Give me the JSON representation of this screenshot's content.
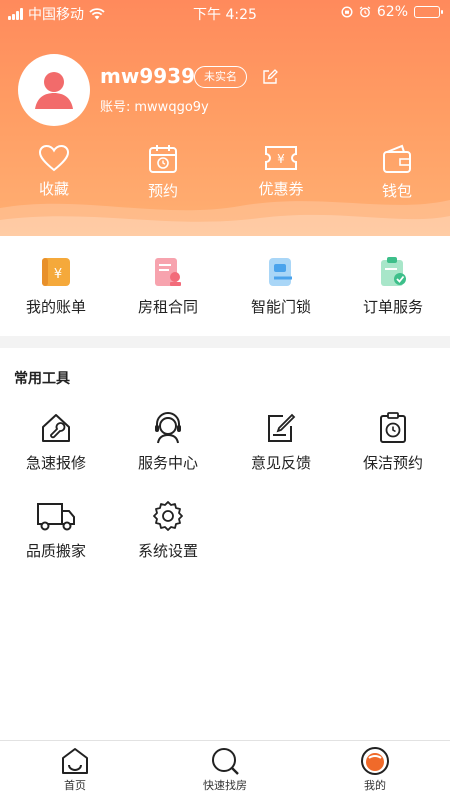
{
  "status_bar": {
    "carrier": "中国移动",
    "time": "下午 4:25",
    "battery": "62%",
    "battery_level": 0.62
  },
  "profile": {
    "username": "mw9939",
    "badge": "未实名",
    "account_label": "账号:",
    "account_id": "mwwqgo9y"
  },
  "quick_actions": [
    {
      "label": "收藏",
      "icon": "heart-icon"
    },
    {
      "label": "预约",
      "icon": "calendar-icon"
    },
    {
      "label": "优惠券",
      "icon": "coupon-icon"
    },
    {
      "label": "钱包",
      "icon": "wallet-icon"
    }
  ],
  "services": [
    {
      "label": "我的账单",
      "icon": "bill-icon",
      "color": "#f5a93b"
    },
    {
      "label": "房租合同",
      "icon": "contract-icon",
      "color": "#f26b7a"
    },
    {
      "label": "智能门锁",
      "icon": "smart-lock-icon",
      "color": "#4aa3ec"
    },
    {
      "label": "订单服务",
      "icon": "order-service-icon",
      "color": "#3dbf8a"
    }
  ],
  "tools_section": {
    "title": "常用工具",
    "items": [
      {
        "label": "急速报修",
        "icon": "repair-icon"
      },
      {
        "label": "服务中心",
        "icon": "customer-service-icon"
      },
      {
        "label": "意见反馈",
        "icon": "feedback-icon"
      },
      {
        "label": "保洁预约",
        "icon": "cleaning-icon"
      },
      {
        "label": "品质搬家",
        "icon": "truck-icon"
      },
      {
        "label": "系统设置",
        "icon": "gear-icon"
      }
    ]
  },
  "tab_bar": [
    {
      "label": "首页",
      "icon": "home-icon",
      "active": false
    },
    {
      "label": "快速找房",
      "icon": "search-icon",
      "active": false
    },
    {
      "label": "我的",
      "icon": "profile-icon",
      "active": true
    }
  ],
  "colors": {
    "header_gradient_top": "#ff8a5c",
    "header_gradient_bottom": "#ffb073",
    "avatar_accent": "#f26b6b",
    "active_tab": "#f06a2a"
  }
}
